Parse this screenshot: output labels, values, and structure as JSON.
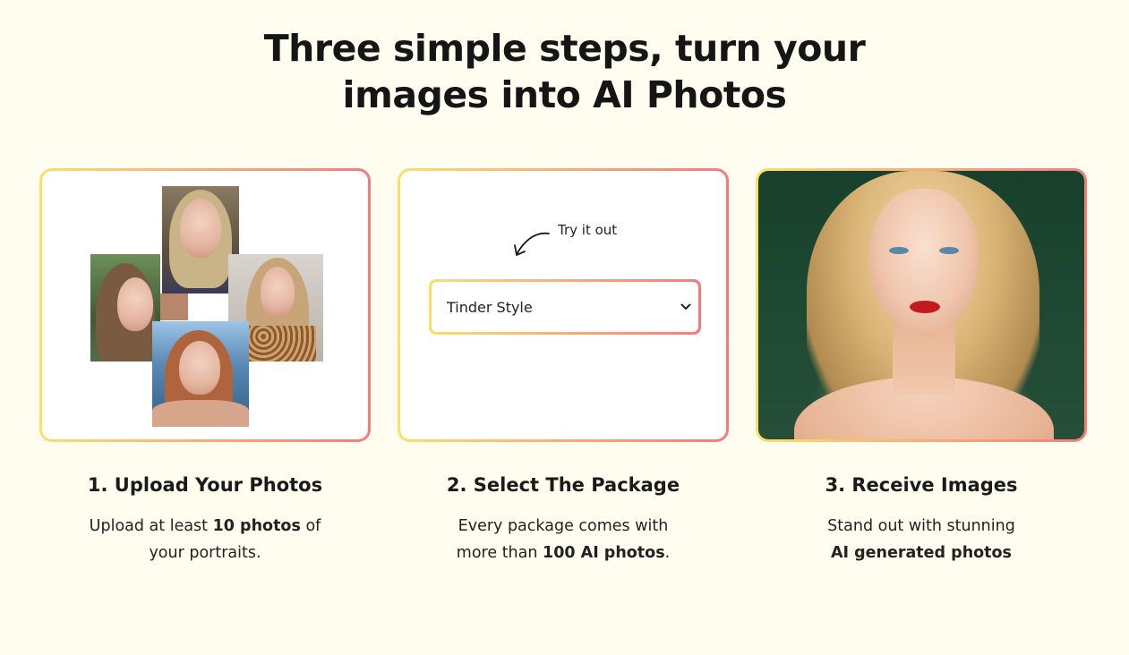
{
  "headline": {
    "line1": "Three simple steps, turn your",
    "line2": "images into AI Photos"
  },
  "card2": {
    "try_label": "Try it out",
    "select_value": "Tinder Style"
  },
  "steps": [
    {
      "title": "1. Upload Your Photos",
      "text_before": "Upload at least ",
      "text_bold": "10 photos",
      "text_after": " of",
      "text_line2": "your portraits."
    },
    {
      "title": "2. Select The Package",
      "text_line1": "Every package comes with",
      "text_before": "more than ",
      "text_bold": "100 AI photos",
      "text_after": "."
    },
    {
      "title": "3. Receive Images",
      "text_line1": "Stand out with stunning",
      "text_bold": "AI generated photos"
    }
  ],
  "colors": {
    "background": "#fefdef",
    "gradient_start": "#f9e06a",
    "gradient_end": "#f27c7c"
  },
  "icons": [
    "curved-arrow-icon",
    "chevron-down-icon"
  ]
}
